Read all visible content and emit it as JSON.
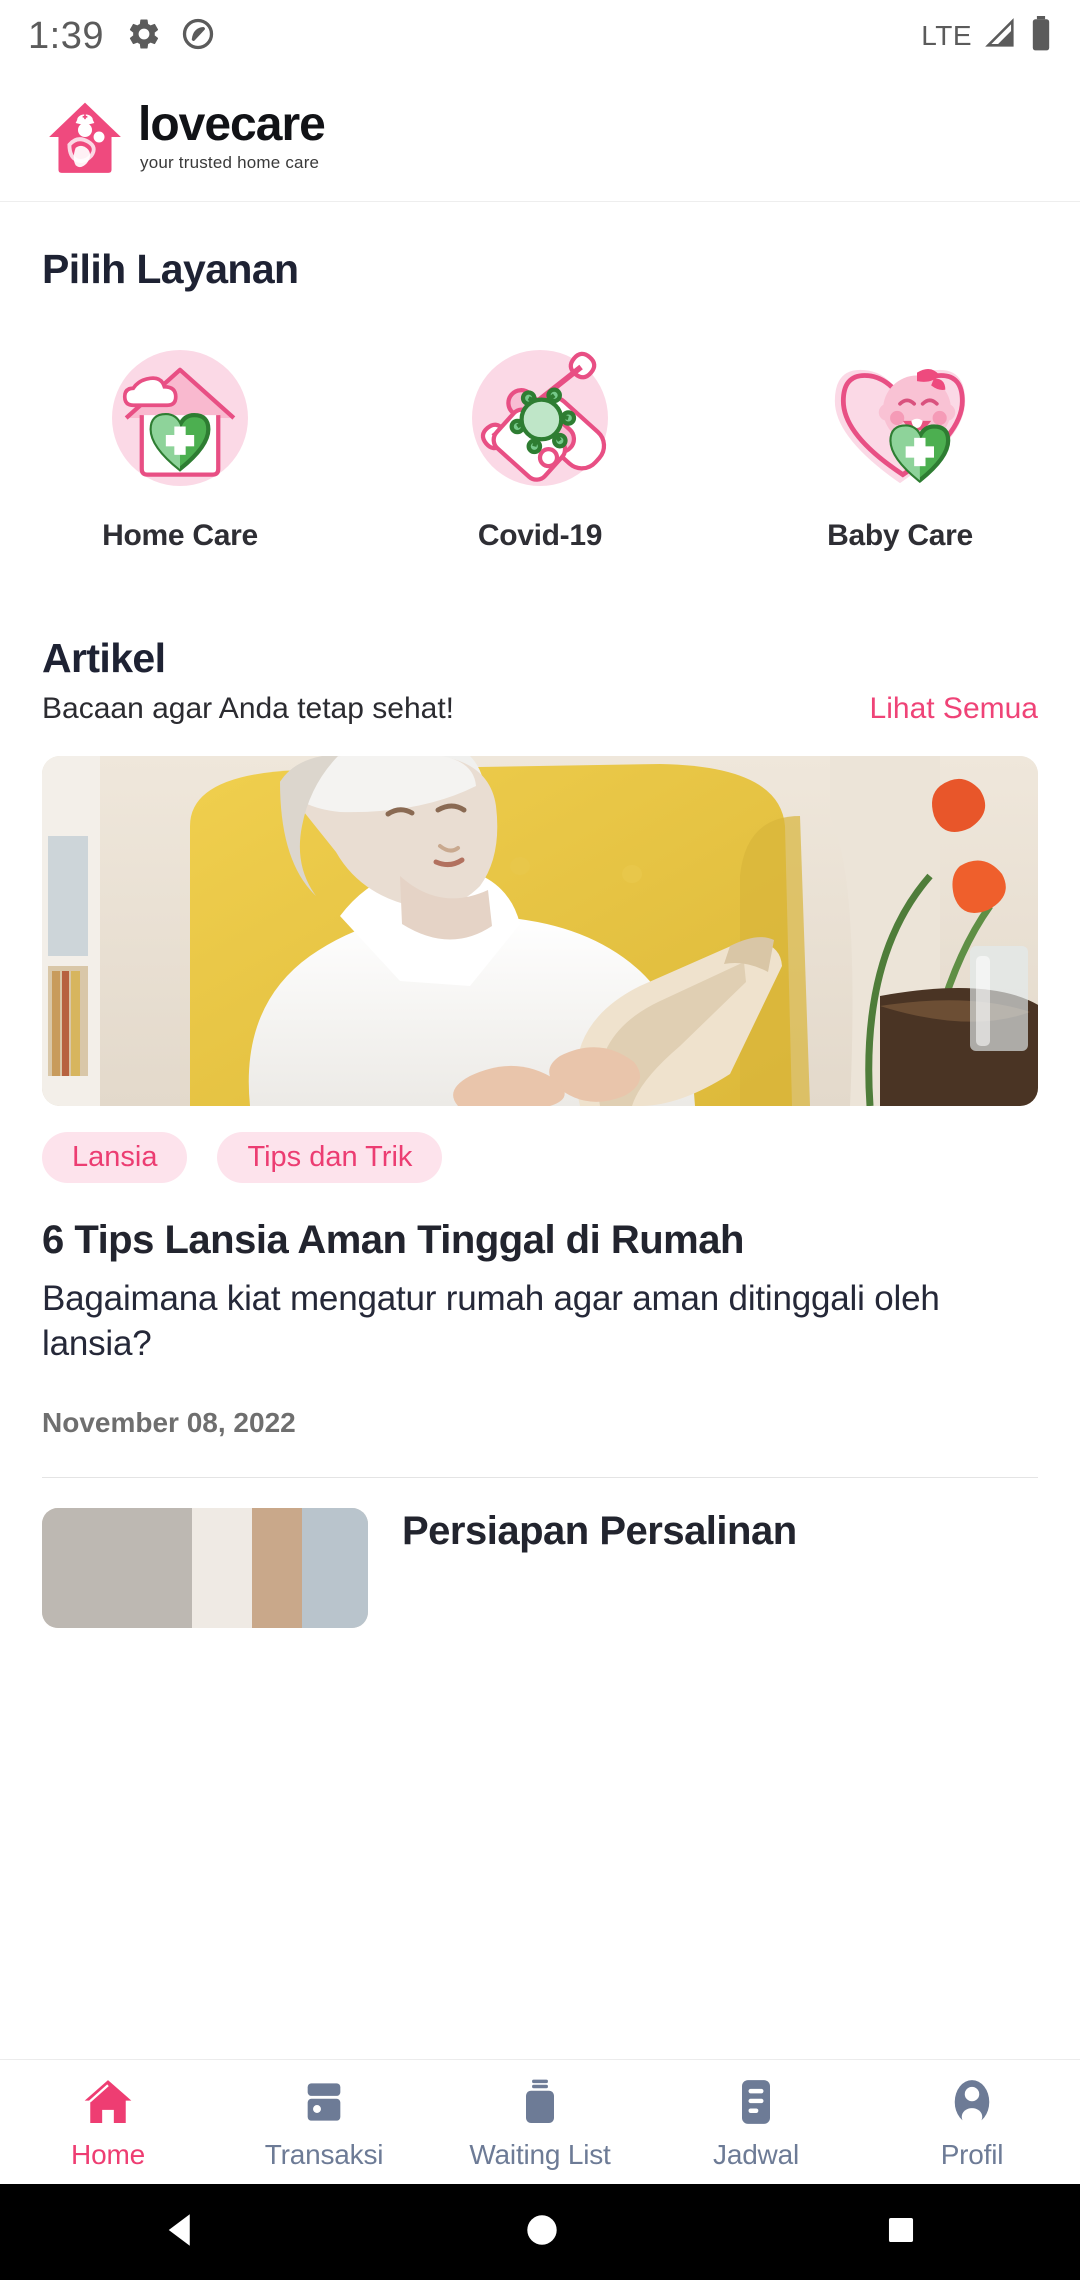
{
  "statusbar": {
    "time": "1:39",
    "network": "LTE",
    "icons": [
      "gear-icon",
      "data-saver-icon",
      "signal-icon",
      "battery-icon"
    ]
  },
  "header": {
    "brand_name": "lovecare",
    "brand_tagline": "your trusted home care",
    "logo_icon": "house-nurse-baby-logo"
  },
  "services_section": {
    "title": "Pilih Layanan",
    "items": [
      {
        "label": "Home Care",
        "icon": "home-care-icon"
      },
      {
        "label": "Covid-19",
        "icon": "covid-test-icon"
      },
      {
        "label": "Baby Care",
        "icon": "baby-care-icon"
      }
    ]
  },
  "articles_section": {
    "title": "Artikel",
    "subtitle": "Bacaan agar Anda tetap sehat!",
    "see_all": "Lihat Semua",
    "items": [
      {
        "tags": [
          "Lansia",
          "Tips dan Trik"
        ],
        "title": "6 Tips Lansia Aman Tinggal di Rumah",
        "description": "Bagaimana kiat mengatur rumah agar aman ditinggali oleh lansia?",
        "date": "November 08, 2022",
        "image": "elderly-woman-reading-book-photo"
      },
      {
        "title": "Persiapan Persalinan",
        "image": "article-thumbnail-photo"
      }
    ]
  },
  "bottom_nav": {
    "active": "Home",
    "items": [
      {
        "label": "Home",
        "icon": "home-icon"
      },
      {
        "label": "Transaksi",
        "icon": "card-icon"
      },
      {
        "label": "Waiting List",
        "icon": "jar-icon"
      },
      {
        "label": "Jadwal",
        "icon": "list-icon"
      },
      {
        "label": "Profil",
        "icon": "person-icon"
      }
    ]
  },
  "system_nav": {
    "back": "back-triangle-icon",
    "home": "home-circle-icon",
    "recents": "recents-square-icon"
  },
  "colors": {
    "brand_pink": "#ee3d72",
    "tag_bg": "#fde3ec",
    "nav_inactive": "#6d7b96",
    "heading": "#1e2233"
  }
}
